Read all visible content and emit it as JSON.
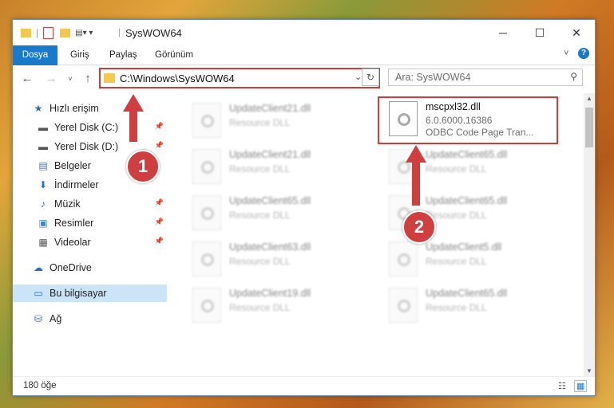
{
  "window": {
    "title": "SysWOW64"
  },
  "ribbon": {
    "tabs": [
      "Dosya",
      "Giriş",
      "Paylaş",
      "Görünüm"
    ]
  },
  "address": {
    "path": "C:\\Windows\\SysWOW64"
  },
  "search": {
    "placeholder": "Ara: SysWOW64"
  },
  "sidebar": {
    "items": [
      {
        "label": "Hızlı erişim",
        "icon": "star-icon"
      },
      {
        "label": "Yerel Disk (C:)",
        "icon": "drive-icon"
      },
      {
        "label": "Yerel Disk (D:)",
        "icon": "drive-icon"
      },
      {
        "label": "Belgeler",
        "icon": "document-icon"
      },
      {
        "label": "İndirmeler",
        "icon": "download-icon"
      },
      {
        "label": "Müzik",
        "icon": "music-icon"
      },
      {
        "label": "Resimler",
        "icon": "pictures-icon"
      },
      {
        "label": "Videolar",
        "icon": "video-icon"
      },
      {
        "label": "OneDrive",
        "icon": "cloud-icon"
      },
      {
        "label": "Bu bilgisayar",
        "icon": "computer-icon"
      },
      {
        "label": "Ağ",
        "icon": "network-icon"
      }
    ]
  },
  "files": {
    "left": [
      {
        "name": "UpdateClient21.dll",
        "type": "Resource DLL"
      },
      {
        "name": "UpdateClient21.dll",
        "type": "Resource DLL"
      },
      {
        "name": "UpdateClient65.dll",
        "type": "Resource DLL"
      },
      {
        "name": "UpdateClient63.dll",
        "type": "Resource DLL"
      },
      {
        "name": "UpdateClient19.dll",
        "type": "Resource DLL"
      }
    ],
    "right": [
      {
        "name": "mscpxl32.dll",
        "version": "6.0.6000.16386",
        "type": "ODBC Code Page Tran..."
      },
      {
        "name": "UpdateClient65.dll",
        "type": "Resource DLL"
      },
      {
        "name": "UpdateClient65.dll",
        "type": "Resource DLL"
      },
      {
        "name": "UpdateClient5.dll",
        "type": "Resource DLL"
      },
      {
        "name": "UpdateClient65.dll",
        "type": "Resource DLL"
      }
    ]
  },
  "callouts": {
    "one": "1",
    "two": "2"
  },
  "status": {
    "count": "180 öğe"
  }
}
